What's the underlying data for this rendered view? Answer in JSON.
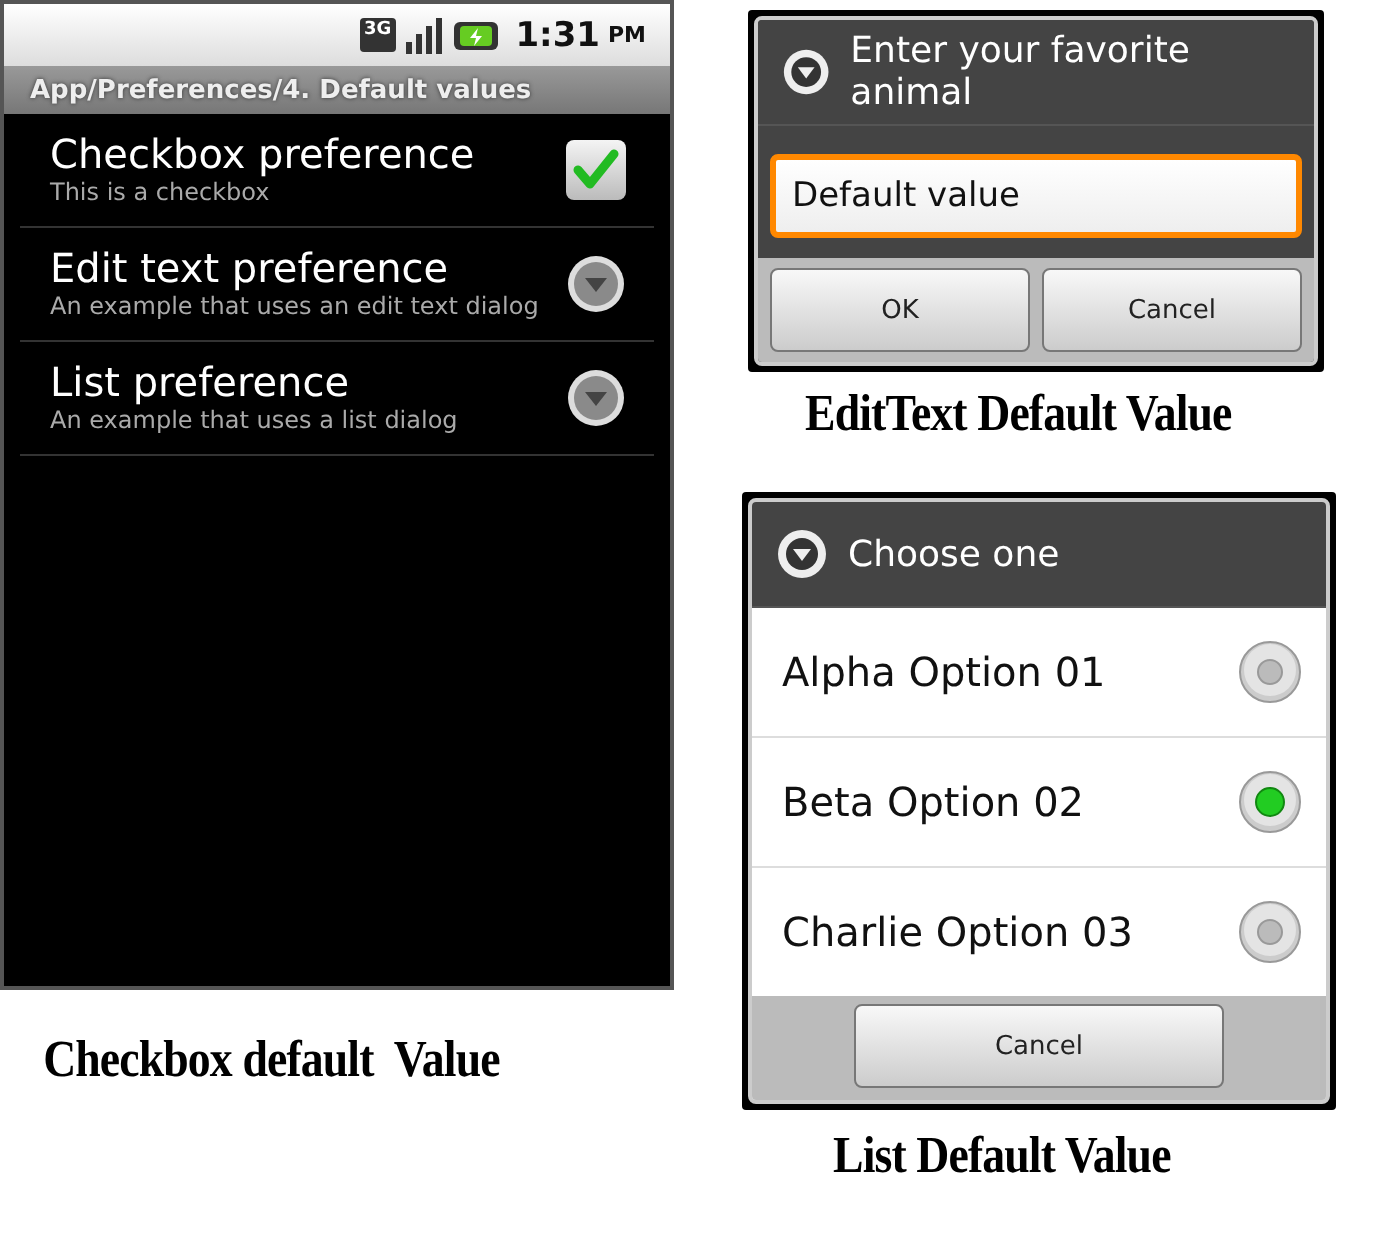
{
  "phone": {
    "status_bar": {
      "network": "3G",
      "time": "1:31",
      "period": "PM"
    },
    "title": "App/Preferences/4. Default values",
    "preferences": [
      {
        "kind": "checkbox",
        "title": "Checkbox preference",
        "summary": "This is a checkbox",
        "checked": true
      },
      {
        "kind": "dialog",
        "title": "Edit text preference",
        "summary": "An example that uses an edit text dialog"
      },
      {
        "kind": "dialog",
        "title": "List preference",
        "summary": "An example that uses a list dialog"
      }
    ]
  },
  "phone_caption": "Checkbox default  Value",
  "edit_dialog": {
    "title": "Enter your favorite animal",
    "value": "Default value",
    "focused": true,
    "buttons": [
      "OK",
      "Cancel"
    ]
  },
  "edit_caption": "EditText Default Value",
  "list_dialog": {
    "title": "Choose one",
    "options": [
      {
        "label": "Alpha Option 01",
        "selected": false
      },
      {
        "label": "Beta Option 02",
        "selected": true
      },
      {
        "label": "Charlie Option 03",
        "selected": false
      }
    ],
    "buttons": [
      "Cancel"
    ]
  },
  "list_caption": "List Default Value"
}
